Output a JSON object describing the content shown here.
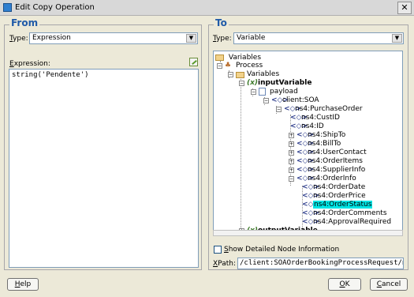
{
  "window": {
    "title": "Edit Copy Operation",
    "close_glyph": "✕"
  },
  "from": {
    "legend": "From",
    "type_label_u": "T",
    "type_label_rest": "ype:",
    "type_value": "Expression",
    "expression_label_u": "E",
    "expression_label_rest": "xpression:",
    "expression_value": "string('Pendente')"
  },
  "to": {
    "legend": "To",
    "type_label_u": "T",
    "type_label_rest": "ype:",
    "type_value": "Variable",
    "tree": {
      "variables": "Variables",
      "process": "Process",
      "variables2": "Variables",
      "input_variable": "inputVariable",
      "payload": "payload",
      "client_soa": "client:SOA",
      "purchase_order": "ns4:PurchaseOrder",
      "cust_id": "ns4:CustID",
      "id": "ns4:ID",
      "ship_to": "ns4:ShipTo",
      "bill_to": "ns4:BillTo",
      "user_contact": "ns4:UserContact",
      "order_items": "ns4:OrderItems",
      "supplier_info": "ns4:SupplierInfo",
      "order_info": "ns4:OrderInfo",
      "order_date": "ns4:OrderDate",
      "order_price": "ns4:OrderPrice",
      "order_status": "ns4:OrderStatus",
      "order_comments": "ns4:OrderComments",
      "approval_required": "ns4:ApprovalRequired",
      "output_variable": "outputVariable"
    },
    "show_details_u": "S",
    "show_details_rest": "how Detailed Node Information",
    "xpath_label_u": "X",
    "xpath_label_rest": "Path:",
    "xpath_value": "/client:SOAOrderBookingProcessRequest/n"
  },
  "buttons": {
    "help_u": "H",
    "help_rest": "elp",
    "ok_u": "O",
    "ok_rest": "K",
    "cancel_u": "C",
    "cancel_rest": "ancel"
  },
  "icons": {
    "expand": "+",
    "collapse": "−",
    "dropdown": "▼",
    "element": "<◇>",
    "variable": "(x)",
    "process": "♣"
  }
}
